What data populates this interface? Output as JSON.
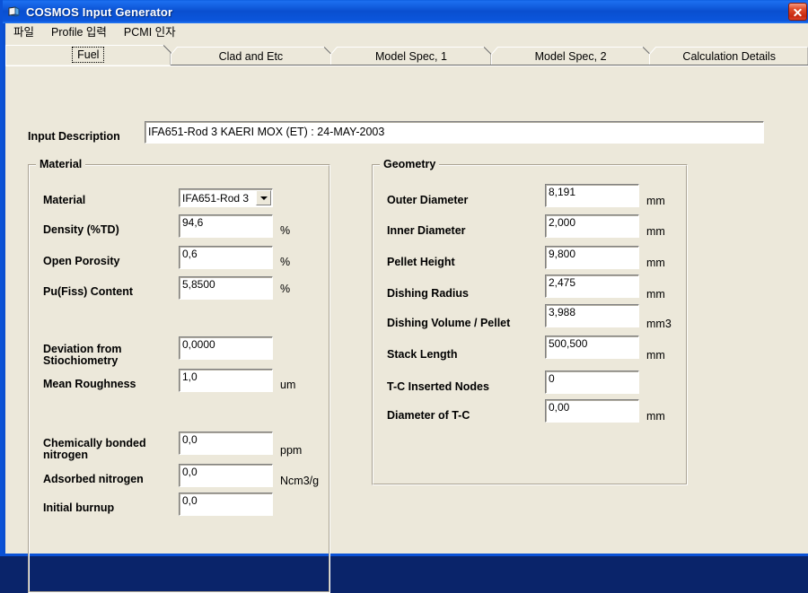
{
  "window": {
    "title": "COSMOS Input Generator",
    "icon": "app-document-icon",
    "close_label": "×",
    "titlebar_color": "#0a4fd0",
    "face_color": "#ece8da"
  },
  "menubar": {
    "items": [
      {
        "label": "파일"
      },
      {
        "label": "Profile 입력"
      },
      {
        "label": "PCMI 인자"
      }
    ]
  },
  "tabs": [
    {
      "label": "Fuel",
      "selected": true
    },
    {
      "label": "Clad and Etc",
      "selected": false
    },
    {
      "label": "Model Spec, 1",
      "selected": false
    },
    {
      "label": "Model Spec, 2",
      "selected": false
    },
    {
      "label": "Calculation Details",
      "selected": false
    }
  ],
  "input_description": {
    "label": "Input Description",
    "value": "IFA651-Rod 3 KAERI MOX (ET) : 24-MAY-2003",
    "placeholder": ""
  },
  "material": {
    "title": "Material",
    "fields": [
      {
        "label": "Material",
        "value": "IFA651-Rod 3",
        "unit": "",
        "type": "combo"
      },
      {
        "label": "Density (%TD)",
        "value": "94,6",
        "unit": "%",
        "type": "text"
      },
      {
        "label": "Open Porosity",
        "value": "0,6",
        "unit": "%",
        "type": "text"
      },
      {
        "label": "Pu(Fiss) Content",
        "value": "5,8500",
        "unit": "%",
        "type": "text"
      },
      {
        "label": "Deviation from\nStiochiometry",
        "value": "0,0000",
        "unit": "",
        "type": "text"
      },
      {
        "label": "Mean Roughness",
        "value": "1,0",
        "unit": "um",
        "type": "text"
      },
      {
        "label": "Chemically bonded\nnitrogen",
        "value": "0,0",
        "unit": "ppm",
        "type": "text"
      },
      {
        "label": "Adsorbed nitrogen",
        "value": "0,0",
        "unit": "Ncm3/g",
        "type": "text"
      },
      {
        "label": "Initial burnup",
        "value": "0,0",
        "unit": "",
        "type": "text"
      }
    ]
  },
  "geometry": {
    "title": "Geometry",
    "fields": [
      {
        "label": "Outer Diameter",
        "value": "8,191",
        "unit": "mm"
      },
      {
        "label": "Inner Diameter",
        "value": "2,000",
        "unit": "mm"
      },
      {
        "label": "Pellet Height",
        "value": "9,800",
        "unit": "mm"
      },
      {
        "label": "Dishing Radius",
        "value": "2,475",
        "unit": "mm"
      },
      {
        "label": "Dishing Volume / Pellet",
        "value": "3,988",
        "unit": "mm3"
      },
      {
        "label": "Stack Length",
        "value": "500,500",
        "unit": "mm"
      },
      {
        "label": "T-C Inserted Nodes",
        "value": "0",
        "unit": ""
      },
      {
        "label": "Diameter of T-C",
        "value": "0,00",
        "unit": "mm"
      }
    ]
  }
}
